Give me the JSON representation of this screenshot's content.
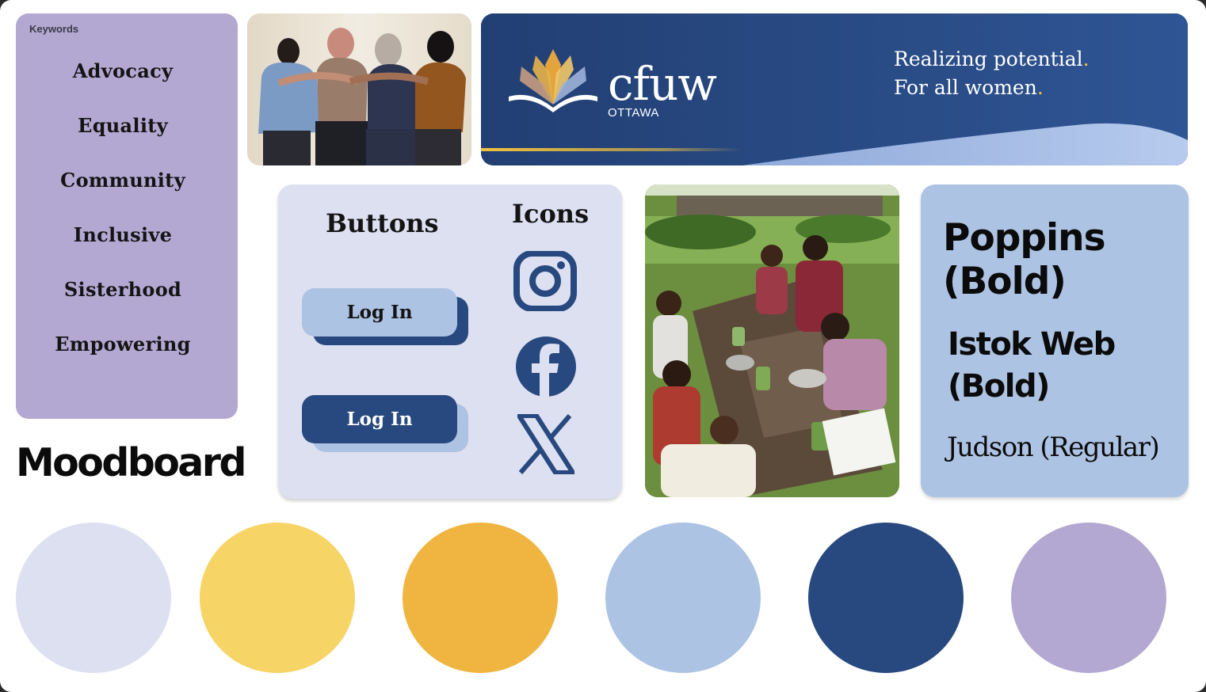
{
  "keywords": {
    "title": "Keywords",
    "items": [
      {
        "label": "Advocacy"
      },
      {
        "label": "Equality"
      },
      {
        "label": "Community"
      },
      {
        "label": "Inclusive"
      },
      {
        "label": "Sisterhood"
      },
      {
        "label": "Empowering"
      }
    ]
  },
  "board": {
    "title": "Moodboard"
  },
  "banner": {
    "logo_text": "cfuw",
    "logo_sub": "OTTAWA",
    "tagline_line1": "Realizing potential",
    "tagline_line2": "For all women",
    "tagline_dot": "."
  },
  "components": {
    "buttons_heading": "Buttons",
    "icons_heading": "Icons",
    "button_light": {
      "label": "Log In",
      "bg": "#adc3e3",
      "shadow": "#28497f",
      "text": "#141414"
    },
    "button_dark": {
      "label": "Log In",
      "bg": "#28497f",
      "shadow": "#adc3e3",
      "text": "#ffffff"
    },
    "icons": [
      {
        "name": "instagram-icon"
      },
      {
        "name": "facebook-icon"
      },
      {
        "name": "x-twitter-icon"
      }
    ]
  },
  "typography": {
    "font1": "Poppins (Bold)",
    "font2": "Istok Web (Bold)",
    "font3": "Judson (Regular)"
  },
  "palette": {
    "colors": [
      "#dde0f1",
      "#f6d466",
      "#f0b540",
      "#adc3e3",
      "#28497f",
      "#b3a8d2"
    ],
    "brand_blue": "#28497f",
    "accent_gold": "#f1c23e"
  }
}
